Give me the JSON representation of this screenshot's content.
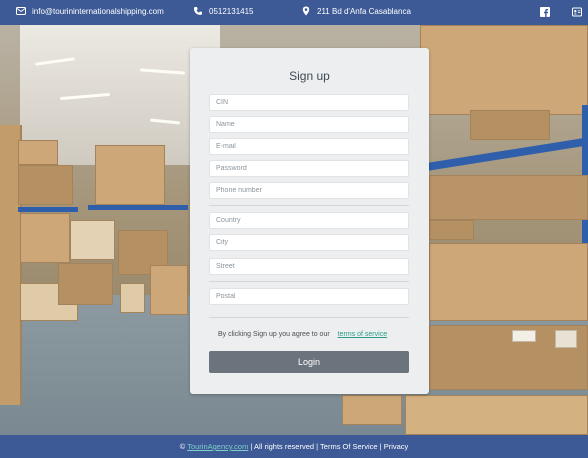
{
  "topbar": {
    "email": "info@tourininternationalshipping.com",
    "phone": "0512131415",
    "address": "211 Bd d'Anfa Casablanca",
    "icons": [
      "envelope-icon",
      "phone-icon",
      "map-pin-icon",
      "facebook-icon",
      "contact-card-icon"
    ]
  },
  "signup": {
    "title": "Sign up",
    "fields": {
      "cin": "CIN",
      "name": "Name",
      "email": "E-mail",
      "password": "Password",
      "phone": "Phone number",
      "country": "Country",
      "city": "City",
      "street": "Street",
      "postal": "Postal"
    },
    "terms_text": "By clicking Sign up you agree to our",
    "terms_link": "terms of service",
    "button": "Login"
  },
  "footer": {
    "copyright": "©",
    "brand_link": "TourinAgency.com",
    "rights": "| All rights reserved",
    "terms": "| Terms Of Service",
    "privacy": "| Privacy"
  },
  "colors": {
    "bar": "#3d5a96",
    "link": "#2a9d87",
    "button": "#6b747c"
  }
}
